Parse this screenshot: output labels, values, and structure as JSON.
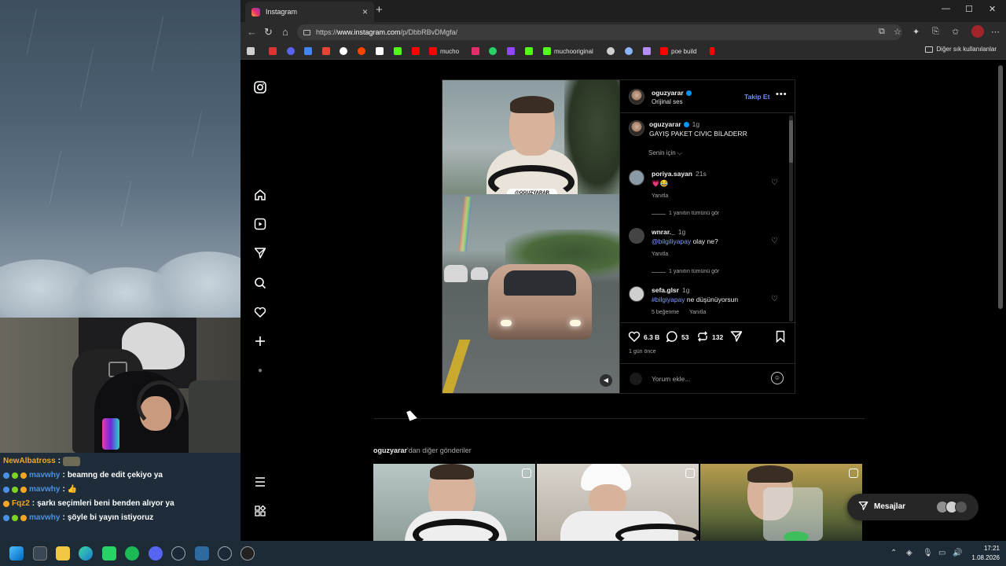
{
  "browser": {
    "tab_title": "Instagram",
    "url_prefix": "https://",
    "url_host": "www.instagram.com",
    "url_path": "/p/DbbRBvDMgfa/",
    "bookmarks": [
      {
        "label": "",
        "color": "#cfcfcf"
      },
      {
        "label": "",
        "color": "#d33"
      },
      {
        "label": "",
        "color": "#5865f2"
      },
      {
        "label": "",
        "color": "#4285f4"
      },
      {
        "label": "",
        "color": "#ea4335"
      },
      {
        "label": "",
        "color": "#fff"
      },
      {
        "label": "",
        "color": "#ff4500"
      },
      {
        "label": "",
        "color": "#fff"
      },
      {
        "label": "",
        "color": "#53fc18"
      },
      {
        "label": "",
        "color": "#ff0000"
      },
      {
        "label": "mucho",
        "color": "#ff0000"
      },
      {
        "label": "",
        "color": "#e1306c"
      },
      {
        "label": "",
        "color": "#25d366"
      },
      {
        "label": "",
        "color": "#9146ff"
      },
      {
        "label": "",
        "color": "#53fc18"
      },
      {
        "label": "muchooriginal",
        "color": "#53fc18"
      },
      {
        "label": "",
        "color": "#cfcfcf"
      },
      {
        "label": "",
        "color": "#8ab4f8"
      },
      {
        "label": "",
        "color": "#b38cff"
      },
      {
        "label": "poe build",
        "color": "#ff0000"
      },
      {
        "label": "",
        "color": "#ff0000"
      }
    ],
    "other_bookmarks": "Diğer sık kullanılanlar"
  },
  "post": {
    "author": "oguzyarar",
    "audio": "Orijinal ses",
    "follow_label": "Takip Et",
    "video_handle": "@OGUZYARAR",
    "caption": {
      "user": "oguzyarar",
      "time": "1g",
      "text": "GAYIŞ PAKET CIVIC BİLADERR"
    },
    "for_you": "Senin için ⌵",
    "comments": [
      {
        "user": "poriya.sayan",
        "time": "21s",
        "text": "💗😂",
        "reply": "Yanıtla",
        "view_replies": "1 yanıtın tümünü gör"
      },
      {
        "user": "wnrar._",
        "time": "1g",
        "mention": "@bilgiliyapay",
        "text": " olay ne?",
        "reply": "Yanıtla",
        "view_replies": "1 yanıtın tümünü gör"
      },
      {
        "user": "sefa.glsr",
        "time": "1g",
        "mention": "#bilgiyapay",
        "text": " ne düşünüyorsun",
        "likes": "5 beğenme",
        "reply": "Yanıtla"
      }
    ],
    "likes": "6.3 B",
    "comment_count": "53",
    "repost_count": "132",
    "posted": "1 gün önce",
    "add_comment_placeholder": "Yorum ekle..."
  },
  "more_from": {
    "user": "oguzyarar",
    "suffix": "'dan diğer gönderiler"
  },
  "messages_label": "Mesajlar",
  "chat": [
    {
      "user": "NewAlbatross",
      "msg": "",
      "color": "#f5a623",
      "emote": true
    },
    {
      "user": "mavwhy",
      "msg": "beamng de edit çekiyo ya",
      "color": "#4a90e2"
    },
    {
      "user": "mavwhy",
      "msg": "👍",
      "color": "#4a90e2"
    },
    {
      "user": "Fqz2",
      "msg": "şarkı seçimleri beni benden alıyor ya",
      "color": "#f5a623"
    },
    {
      "user": "mavwhy",
      "msg": "şöyle bi yayın istiyoruz",
      "color": "#4a90e2"
    }
  ],
  "clock": {
    "time": "17:21",
    "date": "1.08.2026"
  }
}
